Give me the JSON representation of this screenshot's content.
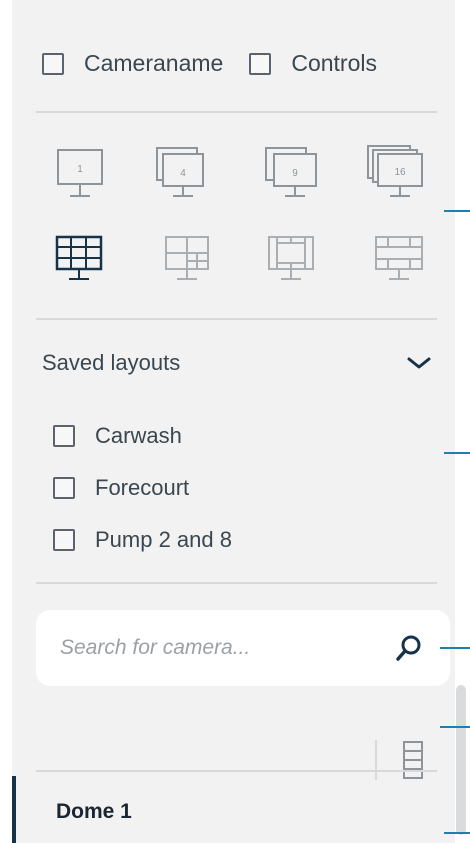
{
  "options": {
    "cameraname_label": "Cameraname",
    "controls_label": "Controls",
    "cameraname_checked": false,
    "controls_checked": false
  },
  "layouts": {
    "single": [
      "1",
      "4",
      "9",
      "16"
    ],
    "multi_icons": [
      "grid-layout-a-icon",
      "grid-layout-b-icon",
      "grid-layout-c-icon",
      "grid-layout-d-icon"
    ],
    "selected_multi_index": 0
  },
  "saved_layouts": {
    "title": "Saved layouts",
    "items": [
      {
        "label": "Carwash",
        "checked": false
      },
      {
        "label": "Forecourt",
        "checked": false
      },
      {
        "label": "Pump 2 and 8",
        "checked": false
      }
    ]
  },
  "search": {
    "placeholder": "Search for camera..."
  },
  "cameras": [
    {
      "label": "Dome 1"
    }
  ],
  "colors": {
    "accent_callout": "#1e7fb4",
    "panel_bg": "#f2f2f2",
    "dark": "#17334a",
    "icon_gray": "#9aa1a6"
  }
}
